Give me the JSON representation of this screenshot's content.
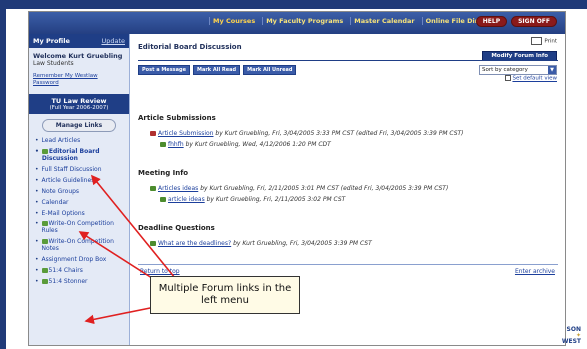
{
  "topnav": {
    "tabs": [
      "My Courses",
      "My Faculty Programs",
      "Master Calendar",
      "Online File Directory"
    ],
    "buttons": [
      "HELP",
      "SIGN OFF"
    ]
  },
  "sidebar": {
    "header": "My Profile",
    "update_link": "Update",
    "welcome": "Welcome Kurt Gruebling",
    "welcome_sub": "Law Students",
    "remember": "Remember My Westlaw Password",
    "org_title": "TU Law Review",
    "org_sub": "(Full Year 2006-2007)",
    "manage_links": "Manage Links",
    "items": [
      {
        "label": "Lead Articles",
        "icon": "none"
      },
      {
        "label": "Editorial Board Discussion",
        "icon": "forum-icon"
      },
      {
        "label": "Full Staff Discussion",
        "icon": "none"
      },
      {
        "label": "Article Guidelines",
        "icon": "none"
      },
      {
        "label": "Note Groups",
        "icon": "none"
      },
      {
        "label": "Calendar",
        "icon": "none"
      },
      {
        "label": "E-Mail Options",
        "icon": "none"
      },
      {
        "label": "Write-On Competition Rules",
        "icon": "forum-icon"
      },
      {
        "label": "Write-On Competition Notes",
        "icon": "forum-icon"
      },
      {
        "label": "Assignment Drop Box",
        "icon": "none"
      },
      {
        "label": "51:4 Chairs",
        "icon": "forum-icon"
      },
      {
        "label": "51:4 Stonner",
        "icon": "forum-icon"
      }
    ]
  },
  "main": {
    "print_label": "Print",
    "title": "Editorial Board Discussion",
    "modify_button": "Modify Forum Info",
    "actions": [
      "Post a Message",
      "Mark All Read",
      "Mark All Unread"
    ],
    "sort_value": "Sort by category",
    "set_default": "Set default view",
    "sections": [
      {
        "title": "Article Submissions",
        "posts": [
          {
            "link": "Article Submission",
            "meta": "by Kurt Gruebling, Fri, 3/04/2005 3:33 PM CST (edited Fri, 3/04/2005 3:39 PM CST)",
            "icon": "red",
            "indent": 0
          },
          {
            "link": "fhhfh",
            "meta": "by Kurt Gruebling, Wed, 4/12/2006 1:20 PM CDT",
            "icon": "green",
            "indent": 1
          }
        ]
      },
      {
        "title": "Meeting Info",
        "posts": [
          {
            "link": "Articles ideas",
            "meta": "by Kurt Gruebling, Fri, 2/11/2005 3:01 PM CST (edited Fri, 3/04/2005 3:39 PM CST)",
            "icon": "green",
            "indent": 0
          },
          {
            "link": "article ideas",
            "meta": "by Kurt Gruebling, Fri, 2/11/2005 3:02 PM CST",
            "icon": "green",
            "indent": 1
          }
        ]
      },
      {
        "title": "Deadline Questions",
        "posts": [
          {
            "link": "What are the deadlines?",
            "meta": "by Kurt Gruebling, Fri, 3/04/2005 3:39 PM CST",
            "icon": "green",
            "indent": 0
          }
        ]
      }
    ],
    "return_top": "Return to top",
    "enter_archive": "Enter archive"
  },
  "callout": {
    "text": "Multiple Forum links in the left menu"
  },
  "logo": {
    "line1": "SON",
    "line2": "WEST"
  }
}
